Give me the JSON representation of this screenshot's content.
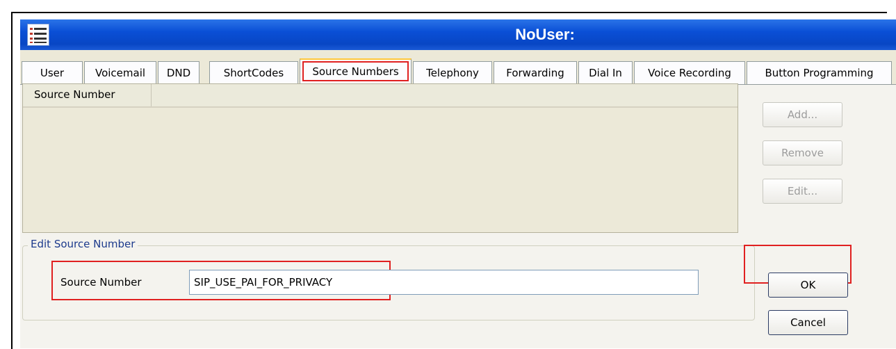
{
  "window": {
    "title": "NoUser:",
    "icon": "app-list-icon"
  },
  "tabs": [
    {
      "label": "User",
      "active": false
    },
    {
      "label": "Voicemail",
      "active": false
    },
    {
      "label": "DND",
      "active": false
    },
    {
      "label": "ShortCodes",
      "active": false
    },
    {
      "label": "Source Numbers",
      "active": true
    },
    {
      "label": "Telephony",
      "active": false
    },
    {
      "label": "Forwarding",
      "active": false
    },
    {
      "label": "Dial In",
      "active": false
    },
    {
      "label": "Voice Recording",
      "active": false
    },
    {
      "label": "Button Programming",
      "active": false
    }
  ],
  "list": {
    "column_header": "Source Number",
    "rows": []
  },
  "buttons": {
    "add": "Add...",
    "remove": "Remove",
    "edit": "Edit...",
    "ok": "OK",
    "cancel": "Cancel"
  },
  "edit_group": {
    "legend": "Edit Source Number",
    "field_label": "Source Number",
    "field_value": "SIP_USE_PAI_FOR_PRIVACY"
  },
  "colors": {
    "titlebar": "#0a4fd6",
    "highlight": "#e02020",
    "active_tab_top": "#ffc83c"
  }
}
